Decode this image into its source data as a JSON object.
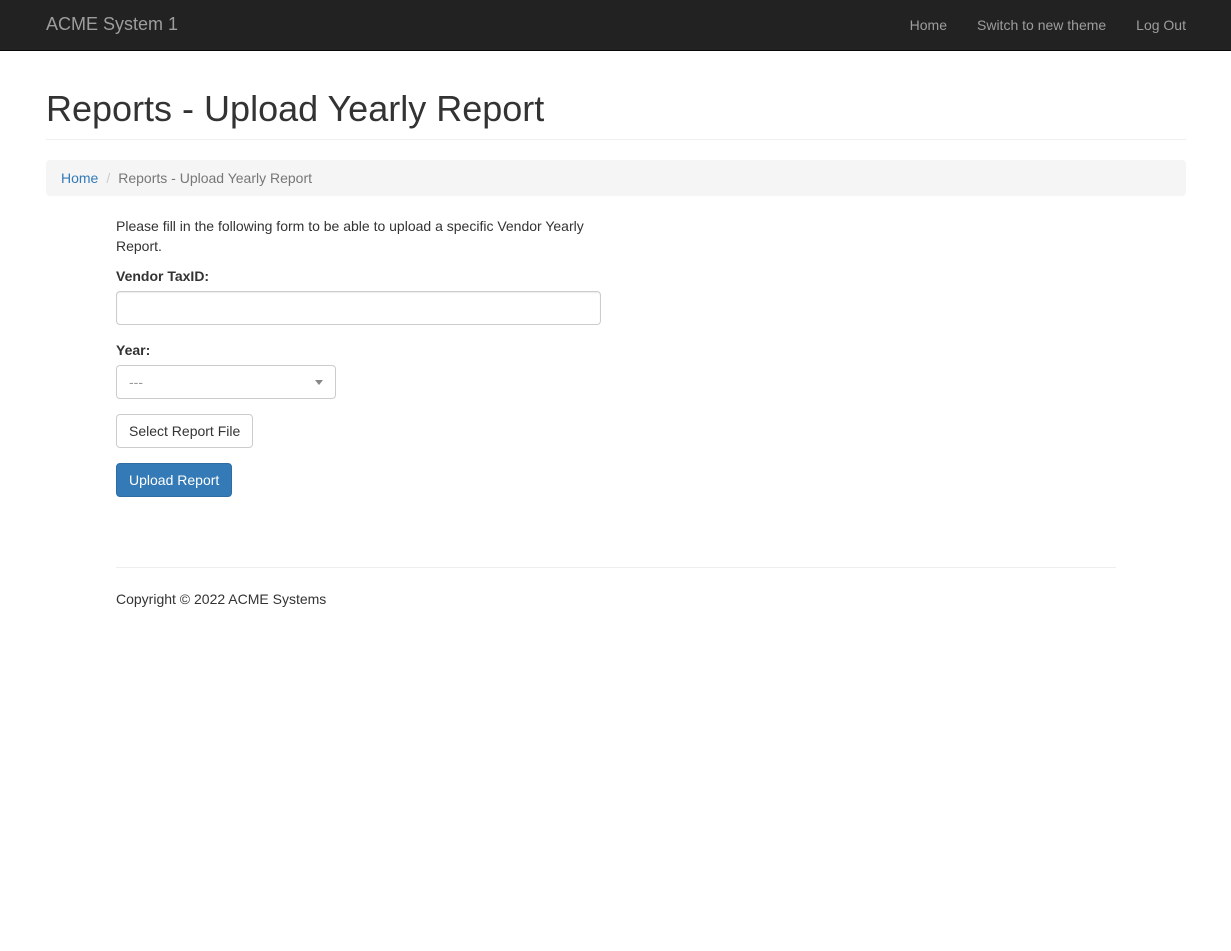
{
  "navbar": {
    "brand": "ACME System 1",
    "links": [
      "Home",
      "Switch to new theme",
      "Log Out"
    ]
  },
  "page": {
    "title": "Reports - Upload Yearly Report"
  },
  "breadcrumb": {
    "home": "Home",
    "separator": "/",
    "current": "Reports - Upload Yearly Report"
  },
  "form": {
    "intro": "Please fill in the following form to be able to upload a specific Vendor Yearly Report.",
    "taxid_label": "Vendor TaxID:",
    "taxid_value": "",
    "year_label": "Year:",
    "year_selected": "---",
    "select_file_label": "Select Report File",
    "upload_label": "Upload Report"
  },
  "footer": {
    "copyright": "Copyright © 2022 ACME Systems"
  },
  "colors": {
    "navbar_bg": "#222222",
    "link": "#337ab7",
    "primary": "#337ab7"
  }
}
